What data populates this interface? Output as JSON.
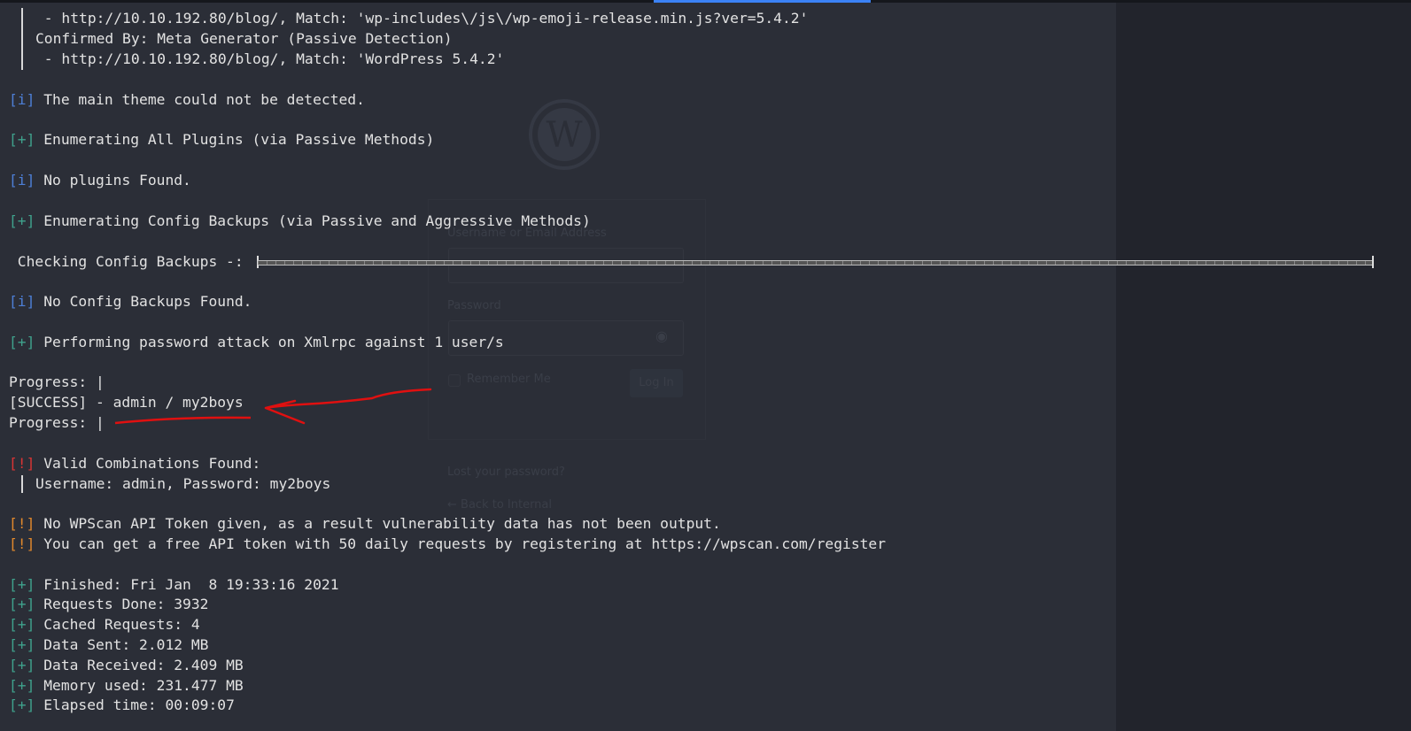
{
  "colors": {
    "info": "#4d7fd6",
    "plus": "#3fa18c",
    "error": "#d93434",
    "warning": "#e0882c",
    "text": "#e2e2e2",
    "background": "#2b2e37",
    "annotation": "#e01010"
  },
  "background_login": {
    "username_label": "Username or Email Address",
    "password_label": "Password",
    "remember_label": "Remember Me",
    "login_button": "Log In",
    "lost_password": "Lost your password?",
    "back_link": "← Back to Internal"
  },
  "lines": [
    {
      "prefix": "",
      "text": " - http://10.10.192.80/blog/, Match: 'wp-includes\\/js\\/wp-emoji-release.min.js?ver=5.4.2'"
    },
    {
      "prefix": "",
      "text": "Confirmed By: Meta Generator (Passive Detection)"
    },
    {
      "prefix": "",
      "text": " - http://10.10.192.80/blog/, Match: 'WordPress 5.4.2'"
    },
    {
      "prefix": "[i]",
      "text": " The main theme could not be detected."
    },
    {
      "prefix": "[+]",
      "text": " Enumerating All Plugins (via Passive Methods)"
    },
    {
      "prefix": "[i]",
      "text": " No plugins Found."
    },
    {
      "prefix": "[+]",
      "text": " Enumerating Config Backups (via Passive and Aggressive Methods)"
    },
    {
      "prefix": "",
      "text": " Checking Config Backups -: "
    },
    {
      "prefix": "[i]",
      "text": " No Config Backups Found."
    },
    {
      "prefix": "[+]",
      "text": " Performing password attack on Xmlrpc against 1 user/s"
    },
    {
      "prefix": "",
      "text": "Progress: |"
    },
    {
      "prefix": "",
      "text": "[SUCCESS] - admin / my2boys"
    },
    {
      "prefix": "",
      "text": "Progress: |"
    },
    {
      "prefix": "[!]",
      "text": " Valid Combinations Found:"
    },
    {
      "prefix": "",
      "text": "Username: admin, Password: my2boys"
    },
    {
      "prefix": "[!]",
      "text": " No WPScan API Token given, as a result vulnerability data has not been output."
    },
    {
      "prefix": "[!]",
      "text": " You can get a free API token with 50 daily requests by registering at https://wpscan.com/register"
    },
    {
      "prefix": "[+]",
      "text": " Finished: Fri Jan  8 19:33:16 2021"
    },
    {
      "prefix": "[+]",
      "text": " Requests Done: 3932"
    },
    {
      "prefix": "[+]",
      "text": " Cached Requests: 4"
    },
    {
      "prefix": "[+]",
      "text": " Data Sent: 2.012 MB"
    },
    {
      "prefix": "[+]",
      "text": " Data Received: 2.409 MB"
    },
    {
      "prefix": "[+]",
      "text": " Memory used: 231.477 MB"
    },
    {
      "prefix": "[+]",
      "text": " Elapsed time: 00:09:07"
    }
  ],
  "progress_bar": {
    "percent": 100
  }
}
